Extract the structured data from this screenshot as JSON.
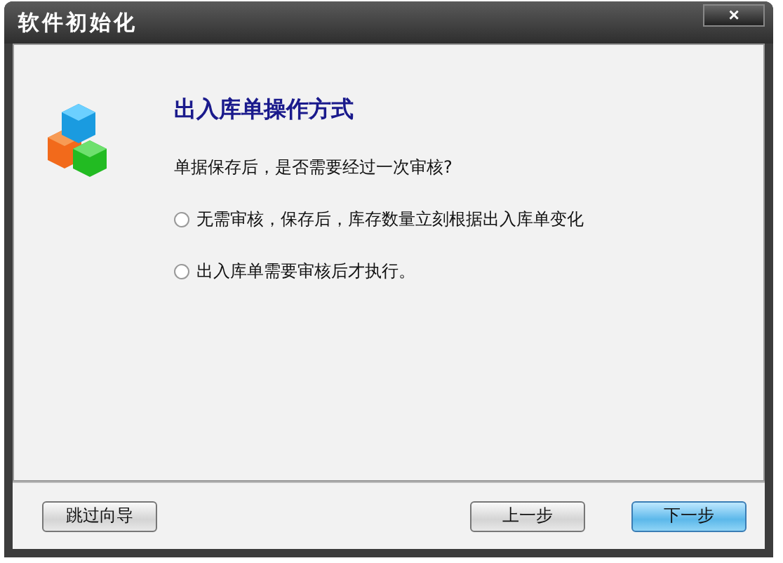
{
  "window": {
    "title": "软件初始化",
    "close": "×"
  },
  "heading": "出入库单操作方式",
  "question": "单据保存后，是否需要经过一次审核?",
  "options": [
    {
      "label": "无需审核，保存后，库存数量立刻根据出入库单变化",
      "selected": false
    },
    {
      "label": "出入库单需要审核后才执行。",
      "selected": false
    }
  ],
  "buttons": [
    {
      "label": "跳过向导",
      "kind": "plain"
    },
    {
      "label": "上一步",
      "kind": "plain"
    },
    {
      "label": "下一步",
      "kind": "default"
    }
  ]
}
